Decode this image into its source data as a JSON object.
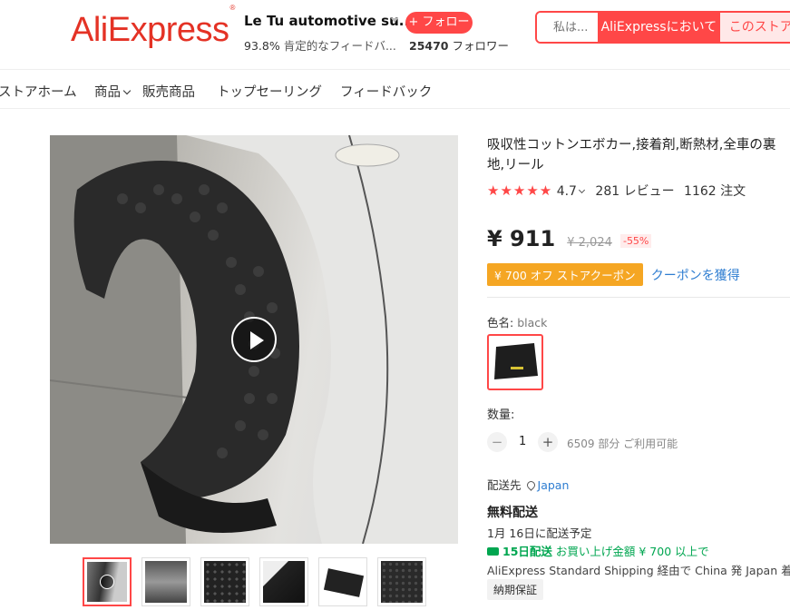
{
  "header": {
    "logo": "AliExpress",
    "logo_mark": "®",
    "store_name": "Le Tu automotive su...",
    "follow_label": "+ フォロー",
    "positive_rate": "93.8%",
    "positive_label": "肯定的なフィードバ...",
    "followers_count": "25470",
    "followers_label": "フォロワー",
    "search_placeholder": "私は...",
    "search_aliexpress": "AliExpressにおいて",
    "search_store": "このストア"
  },
  "nav": {
    "items": [
      {
        "label": "ストアホーム"
      },
      {
        "label": "商品"
      },
      {
        "label": "販売商品"
      },
      {
        "label": "トップセーリング"
      },
      {
        "label": "フィードバック"
      }
    ]
  },
  "product": {
    "title": "吸収性コットンエボカー,接着剤,断熱材,全車の裏地,リール",
    "stars": "★★★★★",
    "rating": "4.7",
    "reviews": "281 レビュー",
    "orders": "1162 注文",
    "price": "¥ 911",
    "original_price": "¥ 2,024",
    "discount": "-55%",
    "coupon": "¥ 700 オフ ストアクーポン",
    "coupon_link": "クーポンを獲得",
    "color_label": "色名:",
    "color_value": "black",
    "quantity_label": "数量:",
    "quantity": "1",
    "qty_minus": "−",
    "qty_plus": "+",
    "available": "6509 部分 ご利用可能",
    "ship_to_label": "配送先",
    "ship_to_country": "Japan",
    "free_shipping": "無料配送",
    "eta": "1月 16日に配送予定",
    "fast_ship_days": "15日配送",
    "fast_ship_text": "お買い上げ金額 ¥ 700 以上で",
    "shipping_method": "AliExpress Standard Shipping 経由で China 発 Japan 着",
    "guarantee": "納期保証"
  },
  "colors": {
    "accent": "#ff4747",
    "brand": "#e43225",
    "coupon": "#f5a623",
    "link": "#2e7dd1",
    "fast": "#00a650"
  },
  "icons": {
    "play": "play-icon",
    "location": "location-pin-icon",
    "truck": "truck-icon"
  }
}
